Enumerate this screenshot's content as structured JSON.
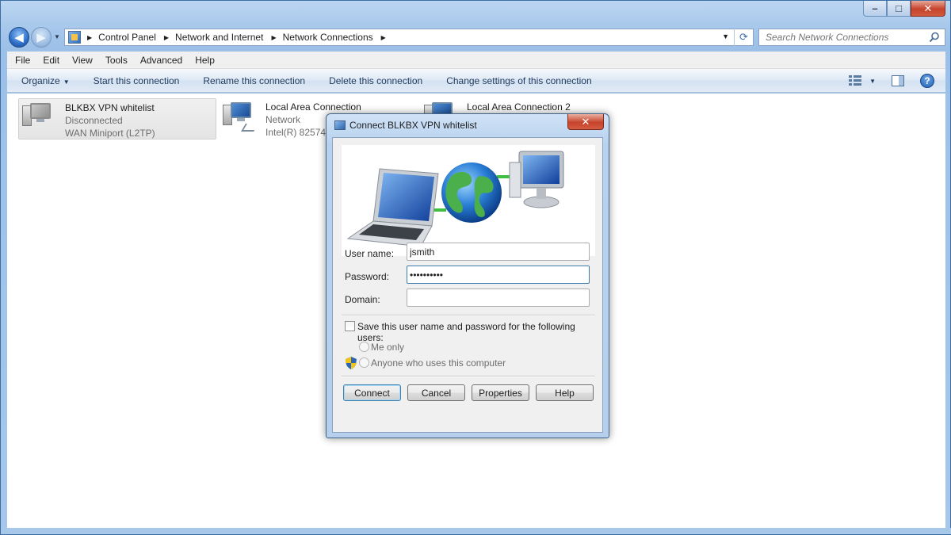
{
  "window": {
    "caption_buttons": {
      "minimize": "–",
      "maximize": "□",
      "close": "✕"
    }
  },
  "nav": {
    "back_glyph": "◀",
    "forward_glyph": "▶",
    "breadcrumbs": [
      "Control Panel",
      "Network and Internet",
      "Network Connections"
    ],
    "breadcrumb_sep": "▶",
    "dropdown_glyph": "▼",
    "refresh_glyph": "⟳",
    "search_placeholder": "Search Network Connections"
  },
  "menu": [
    "File",
    "Edit",
    "View",
    "Tools",
    "Advanced",
    "Help"
  ],
  "commands": {
    "organize": "Organize",
    "caret": "▼",
    "items": [
      "Start this connection",
      "Rename this connection",
      "Delete this connection",
      "Change settings of this connection"
    ],
    "help_glyph": "?"
  },
  "connections": [
    {
      "name": "BLKBX VPN whitelist",
      "status": "Disconnected",
      "device": "WAN Miniport (L2TP)",
      "selected": true
    },
    {
      "name": "Local Area Connection",
      "status": "Network",
      "device": "Intel(R) 82574L",
      "selected": false
    },
    {
      "name": "Local Area Connection 2",
      "status": "",
      "device": "",
      "selected": false
    }
  ],
  "dialog": {
    "title": "Connect BLKBX VPN whitelist",
    "close_glyph": "✕",
    "username_label": "User name:",
    "username_value": "jsmith",
    "password_label": "Password:",
    "password_value": "••••••••••",
    "domain_label": "Domain:",
    "domain_value": "",
    "save_label": "Save this user name and password for the following users:",
    "save_checked": false,
    "radio_me_only": "Me only",
    "radio_anyone": "Anyone who uses this computer",
    "buttons": {
      "connect": "Connect",
      "cancel": "Cancel",
      "properties": "Properties",
      "help": "Help"
    }
  },
  "colors": {
    "accent": "#3c7fb1",
    "title_bar": "#b7d1ee",
    "command_text": "#1e395b",
    "close_red": "#c7432b"
  }
}
